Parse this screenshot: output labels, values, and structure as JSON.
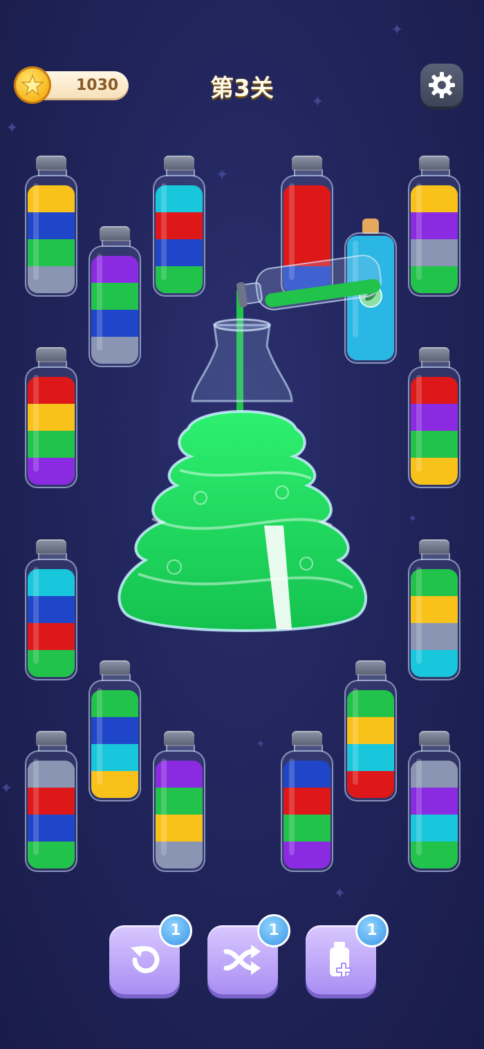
{
  "header": {
    "coins": "1030",
    "coin_icon": "star-coin-icon",
    "level_title": "第3关",
    "settings_icon": "gear-icon"
  },
  "colors": {
    "yellow": "#f9c21b",
    "blue": "#1f46c8",
    "green": "#21c34a",
    "gray": "#8a95b4",
    "cyan": "#18c7dc",
    "red": "#de1818",
    "purple": "#8a2be2"
  },
  "tubes": [
    {
      "id": "t1",
      "layers": [
        "yellow",
        "blue",
        "green",
        "gray"
      ]
    },
    {
      "id": "t2",
      "layers": [
        "cyan",
        "red",
        "blue",
        "green"
      ]
    },
    {
      "id": "t3",
      "layers": [
        "red",
        "red",
        "red",
        "blue"
      ]
    },
    {
      "id": "t4",
      "layers": [
        "yellow",
        "purple",
        "gray",
        "green"
      ]
    },
    {
      "id": "t5",
      "layers": [
        "purple",
        "green",
        "blue",
        "gray"
      ]
    },
    {
      "id": "t6",
      "layers": [
        "cyan",
        "cyan",
        "cyan",
        "cyan"
      ]
    },
    {
      "id": "t7",
      "layers": [
        "red",
        "yellow",
        "green",
        "purple"
      ]
    },
    {
      "id": "t8",
      "layers": [
        "red",
        "purple",
        "green",
        "yellow"
      ]
    },
    {
      "id": "t9",
      "layers": [
        "cyan",
        "blue",
        "red",
        "green"
      ]
    },
    {
      "id": "t10",
      "layers": [
        "green",
        "yellow",
        "gray",
        "cyan"
      ]
    },
    {
      "id": "t11",
      "layers": [
        "green",
        "blue",
        "cyan",
        "yellow"
      ]
    },
    {
      "id": "t12",
      "layers": [
        "green",
        "yellow",
        "cyan",
        "red"
      ]
    },
    {
      "id": "t13",
      "layers": [
        "gray",
        "red",
        "blue",
        "green"
      ]
    },
    {
      "id": "t14",
      "layers": [
        "purple",
        "green",
        "yellow",
        "gray"
      ]
    },
    {
      "id": "t15",
      "layers": [
        "blue",
        "red",
        "green",
        "purple"
      ]
    },
    {
      "id": "t16",
      "layers": [
        "gray",
        "purple",
        "cyan",
        "green"
      ]
    }
  ],
  "special_bottle": {
    "name": "leaf-bottle",
    "liquid": "cyan",
    "icon": "leaf-icon"
  },
  "pouring_tube": {
    "liquid": "green"
  },
  "center_flask": {
    "shape": "christmas-tree-flask",
    "liquid": "green"
  },
  "tools": [
    {
      "name": "undo",
      "icon": "undo-icon",
      "count": "1"
    },
    {
      "name": "shuffle",
      "icon": "shuffle-icon",
      "count": "1"
    },
    {
      "name": "add-tube",
      "icon": "add-bottle-icon",
      "count": "1"
    }
  ]
}
